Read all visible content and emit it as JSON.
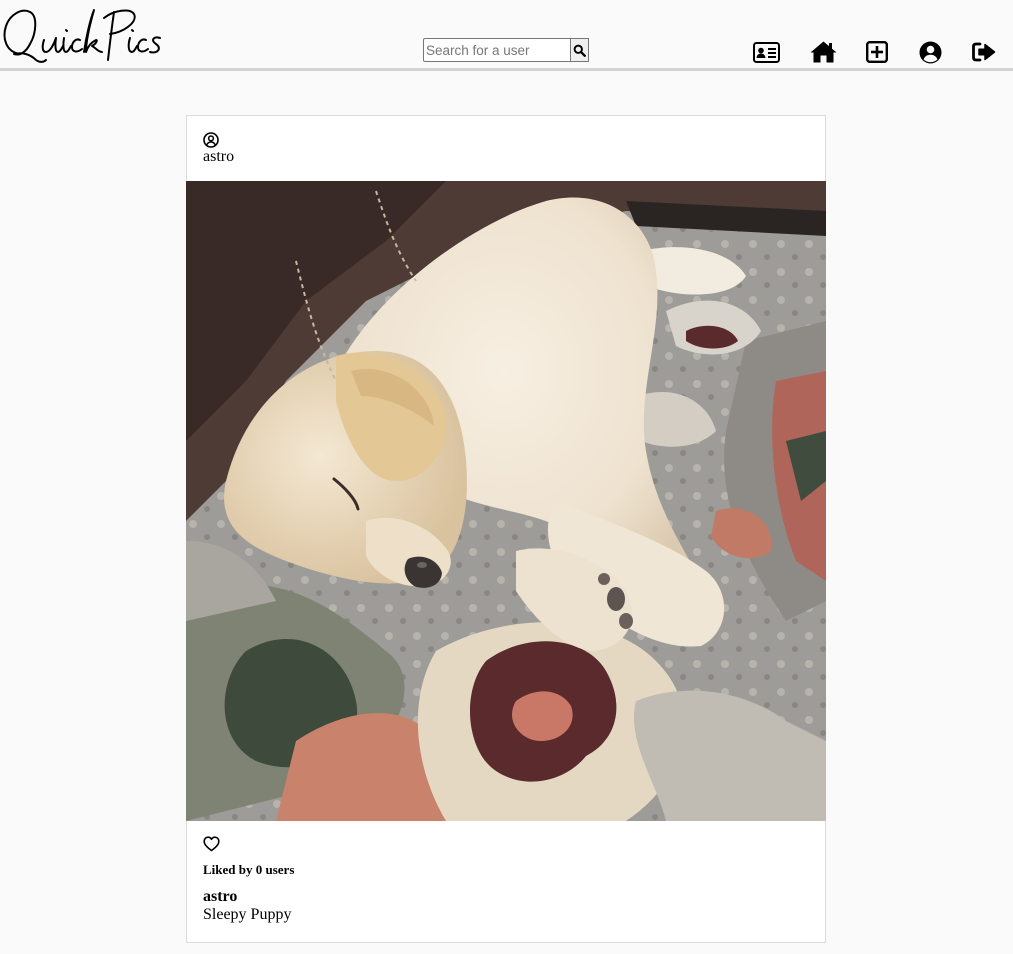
{
  "brand": {
    "logo_text": "Quick Pics"
  },
  "search": {
    "placeholder": "Search for a user",
    "button_icon": "search-icon"
  },
  "nav": {
    "icons": [
      "profile-card-icon",
      "home-icon",
      "add-post-icon",
      "account-icon",
      "logout-icon"
    ]
  },
  "post": {
    "author": "astro",
    "image_alt": "Sleepy Puppy",
    "likes_text": "Liked by 0 users",
    "caption_user": "astro",
    "caption": "Sleepy Puppy"
  },
  "colors": {
    "background": "#fafafa",
    "card": "#ffffff",
    "border": "#dbdbdb",
    "header_rule": "#d3d3d3",
    "icon": "#000000"
  }
}
